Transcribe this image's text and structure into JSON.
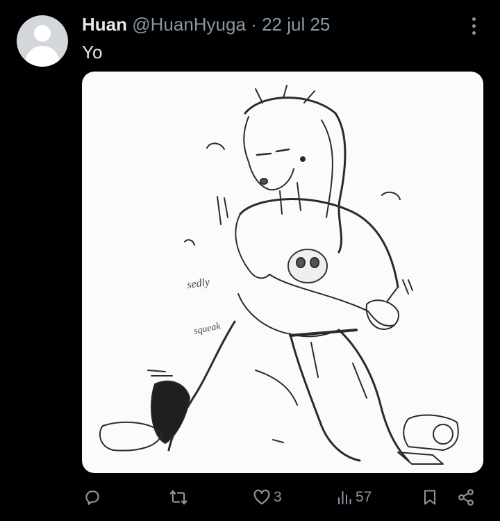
{
  "tweet": {
    "author_name": "Huan",
    "handle": "@HuanHyuga",
    "separator": "·",
    "date": "22 jul 25",
    "text": "Yo",
    "media_text": {
      "line1": "sedly",
      "line2": "squeak"
    }
  },
  "actions": {
    "reply": {
      "icon": "reply-icon",
      "count": ""
    },
    "retweet": {
      "icon": "retweet-icon",
      "count": ""
    },
    "like": {
      "icon": "heart-icon",
      "count": "3"
    },
    "views": {
      "icon": "views-icon",
      "count": "57"
    },
    "bookmark": {
      "icon": "bookmark-icon"
    },
    "share": {
      "icon": "share-icon"
    }
  },
  "colors": {
    "background": "#000000",
    "primary_text": "#e7e9ea",
    "secondary_text": "#8b98a5"
  }
}
